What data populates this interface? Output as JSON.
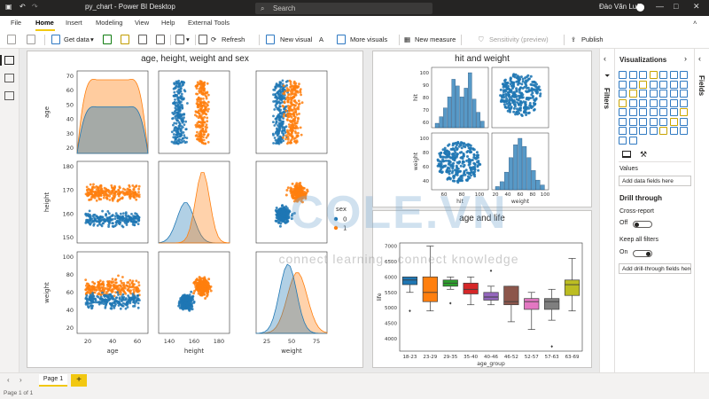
{
  "titlebar": {
    "doc_title": "py_chart - Power BI Desktop",
    "search_placeholder": "Search",
    "user_name": "Đào Văn Luân",
    "save_icon": "save-icon",
    "undo_icon": "undo-icon",
    "redo_icon": "redo-icon"
  },
  "menu": {
    "file": "File",
    "home": "Home",
    "insert": "Insert",
    "modeling": "Modeling",
    "view": "View",
    "help": "Help",
    "external_tools": "External Tools"
  },
  "ribbon": {
    "get_data": "Get data",
    "refresh": "Refresh",
    "new_visual": "New visual",
    "more_visuals": "More visuals",
    "new_measure": "New measure",
    "sensitivity": "Sensitivity (preview)",
    "publish": "Publish"
  },
  "visuals": {
    "pairplot_title": "age, height, weight and sex",
    "hw_title": "hit and weight",
    "box_title": "age and life"
  },
  "pairplot": {
    "xlabels": [
      "age",
      "height",
      "weight"
    ],
    "ylabels": [
      "age",
      "height",
      "weight"
    ],
    "age_ticks": [
      "20",
      "40",
      "60"
    ],
    "height_ticks": [
      "140",
      "160",
      "180"
    ],
    "weight_ticks": [
      "25",
      "50",
      "75"
    ],
    "row_age_ticks": [
      "70",
      "60",
      "50",
      "40",
      "30",
      "20"
    ],
    "row_height_ticks": [
      "180",
      "170",
      "160",
      "150"
    ],
    "row_weight_ticks": [
      "100",
      "80",
      "60",
      "40",
      "20"
    ],
    "legend_title": "sex",
    "legend_items": [
      "0",
      "1"
    ],
    "colors": {
      "sex0": "#1f77b4",
      "sex1": "#ff7f0e"
    }
  },
  "hw": {
    "ylabel_top": "hit",
    "ylabel_bottom": "weight",
    "xlabel_left": "hit",
    "xlabel_right": "weight",
    "y_ticks_top": [
      "100",
      "90",
      "80",
      "70",
      "60"
    ],
    "y_ticks_bottom": [
      "100",
      "80",
      "60",
      "40"
    ],
    "x_ticks_left": [
      "60",
      "80",
      "100"
    ],
    "x_ticks_right": [
      "20",
      "40",
      "60",
      "80",
      "100"
    ]
  },
  "chart_data": [
    {
      "type": "box",
      "title": "age and life",
      "xlabel": "age_group",
      "ylabel": "life",
      "ylim": [
        3600,
        7100
      ],
      "y_ticks": [
        4000,
        4500,
        5000,
        5500,
        6000,
        6500,
        7000
      ],
      "categories": [
        "18-23",
        "23-29",
        "29-35",
        "35-40",
        "40-46",
        "46-52",
        "52-57",
        "57-63",
        "63-69"
      ],
      "colors": [
        "#1f77b4",
        "#ff7f0e",
        "#2ca02c",
        "#d62728",
        "#9467bd",
        "#8c564b",
        "#e377c2",
        "#7f7f7f",
        "#bcbd22"
      ],
      "boxes": [
        {
          "min": 5500,
          "q1": 5750,
          "median": 5900,
          "q3": 6000,
          "max": 6000,
          "outliers": [
            4900
          ]
        },
        {
          "min": 4900,
          "q1": 5200,
          "median": 5500,
          "q3": 6000,
          "max": 7000,
          "outliers": []
        },
        {
          "min": 5600,
          "q1": 5700,
          "median": 5800,
          "q3": 5900,
          "max": 6000,
          "outliers": [
            5150
          ]
        },
        {
          "min": 5100,
          "q1": 5450,
          "median": 5600,
          "q3": 5800,
          "max": 6000,
          "outliers": []
        },
        {
          "min": 5100,
          "q1": 5250,
          "median": 5350,
          "q3": 5500,
          "max": 5700,
          "outliers": [
            6200
          ]
        },
        {
          "min": 4550,
          "q1": 5100,
          "median": 5200,
          "q3": 5700,
          "max": 5700,
          "outliers": []
        },
        {
          "min": 4300,
          "q1": 4950,
          "median": 5200,
          "q3": 5300,
          "max": 5500,
          "outliers": []
        },
        {
          "min": 4600,
          "q1": 4950,
          "median": 5200,
          "q3": 5300,
          "max": 5600,
          "outliers": [
            3750
          ]
        },
        {
          "min": 4900,
          "q1": 5400,
          "median": 5750,
          "q3": 5900,
          "max": 6600,
          "outliers": []
        }
      ]
    },
    {
      "type": "histogram",
      "title": "hit",
      "x_ticks": [
        60,
        80,
        100
      ],
      "values": [
        2,
        5,
        9,
        14,
        22,
        19,
        14,
        18,
        25,
        13,
        7,
        3
      ]
    },
    {
      "type": "histogram",
      "title": "weight",
      "x_ticks": [
        20,
        40,
        60,
        80,
        100
      ],
      "values": [
        2,
        5,
        11,
        20,
        28,
        32,
        27,
        20,
        12,
        6,
        3
      ]
    }
  ],
  "panes": {
    "filters": "Filters",
    "visualizations": "Visualizations",
    "fields": "Fields",
    "values_label": "Values",
    "values_placeholder": "Add data fields here",
    "drill_through": "Drill through",
    "cross_report": "Cross-report",
    "cross_report_state": "Off",
    "keep_filters": "Keep all filters",
    "keep_filters_state": "On",
    "drill_placeholder": "Add drill-through fields here"
  },
  "tabs": {
    "page1": "Page 1",
    "add": "+"
  },
  "status": {
    "page_count": "Page 1 of 1"
  },
  "watermark": {
    "logo": "COLE.VN",
    "tagline": "connect learning - connect knowledge"
  }
}
